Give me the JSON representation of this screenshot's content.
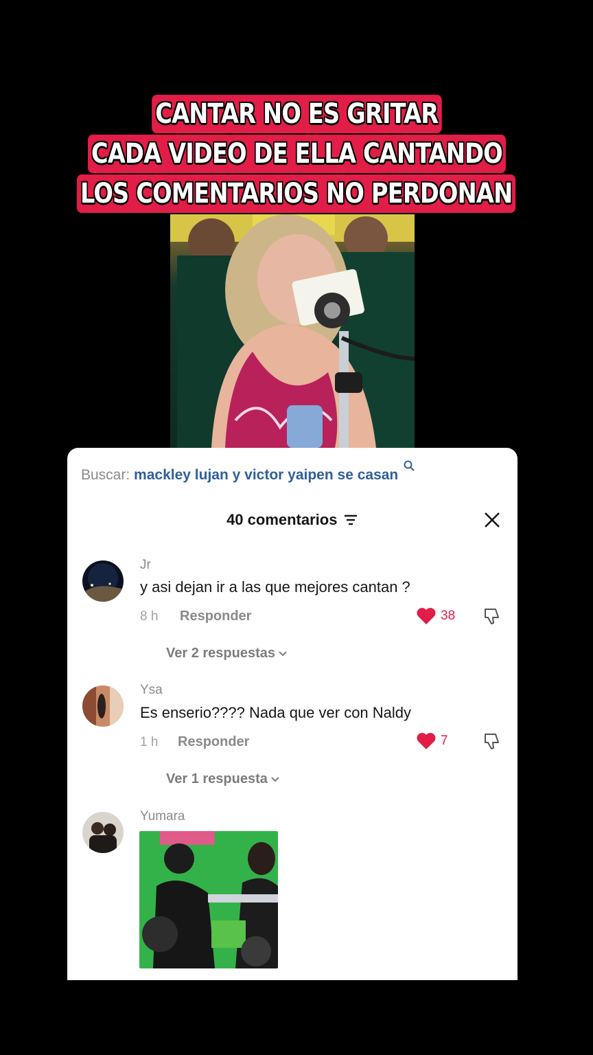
{
  "headline": {
    "line1": "CANTAR NO ES GRITAR",
    "line2": "CADA VIDEO DE ELLA CANTANDO",
    "line3": "LOS COMENTARIOS NO PERDONAN"
  },
  "search": {
    "label": "Buscar:",
    "query": "mackley lujan y victor yaipen se casan"
  },
  "comments_header": {
    "count": "40 comentarios"
  },
  "comments": [
    {
      "user": "Jr",
      "text": "y asi dejan ir a las que mejores cantan ?",
      "time": "8 h",
      "reply_label": "Responder",
      "likes": "38",
      "view_replies": "Ver 2 respuestas"
    },
    {
      "user": "Ysa",
      "text": "Es enserio???? Nada que ver con Naldy",
      "time": "1 h",
      "reply_label": "Responder",
      "likes": "7",
      "view_replies": "Ver 1 respuesta"
    },
    {
      "user": "Yumara"
    }
  ],
  "colors": {
    "accent": "#e11d48",
    "link": "#2f5f9c",
    "muted": "#8a8a8a"
  },
  "icons": [
    "search-icon",
    "filter-icon",
    "close-icon",
    "heart-icon",
    "dislike-icon",
    "chevron-down-icon"
  ]
}
